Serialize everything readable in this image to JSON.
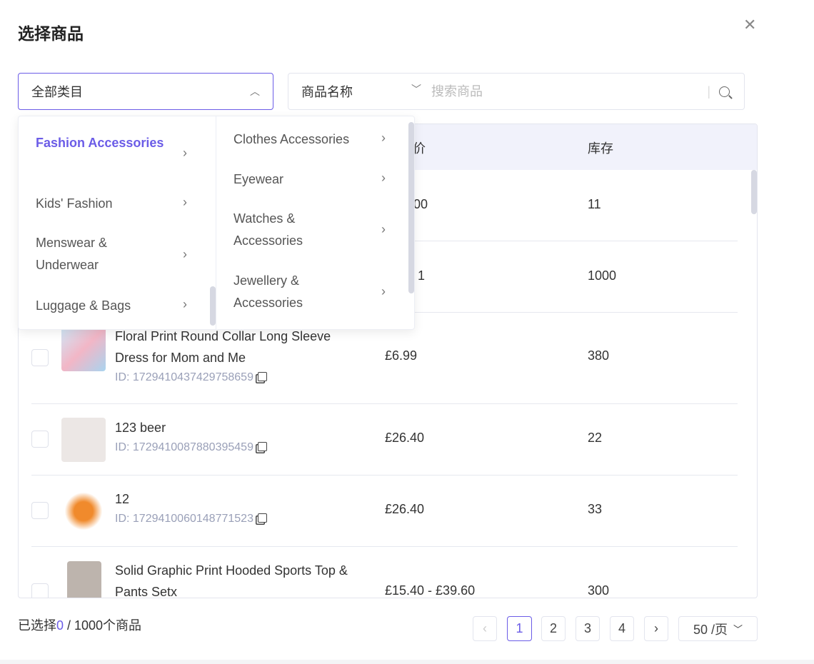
{
  "dialog": {
    "title": "选择商品",
    "close_icon": "close-icon"
  },
  "filters": {
    "category": "全部类目",
    "search_field": "商品名称",
    "search_placeholder": "搜索商品"
  },
  "table": {
    "headers": {
      "price": "价",
      "stock": "库存"
    },
    "rows": [
      {
        "name": "",
        "id": "",
        "price": "00",
        "stock": "11"
      },
      {
        "name": "",
        "id": "",
        "price": "1",
        "stock": "1000"
      },
      {
        "name": "Floral Print Round Collar Long Sleeve Dress for Mom and Me",
        "id": "ID: 1729410437429758659",
        "price": "£6.99",
        "stock": "380"
      },
      {
        "name": "123 beer",
        "id": "ID: 1729410087880395459",
        "price": "£26.40",
        "stock": "22"
      },
      {
        "name": "12",
        "id": "ID: 1729410060148771523",
        "price": "£26.40",
        "stock": "33"
      },
      {
        "name": "Solid Graphic Print Hooded Sports Top & Pants Setx",
        "id": "",
        "price": "£15.40 - £39.60",
        "stock": "300"
      }
    ]
  },
  "dropdown": {
    "level1": [
      "Fashion Accessories",
      "Kids' Fashion",
      "Menswear & Underwear",
      "Luggage & Bags"
    ],
    "level2": [
      "Clothes Accessories",
      "Eyewear",
      "Watches & Accessories",
      "Jewellery & Accessories"
    ],
    "active": "Fashion Accessories"
  },
  "footer": {
    "selected_prefix": "已选择",
    "selected_count": "0",
    "selected_suffix": " / 1000个商品",
    "pages": [
      "1",
      "2",
      "3",
      "4"
    ],
    "current_page": "1",
    "page_size": "50 /页"
  },
  "colors": {
    "accent": "#6b5ce7"
  }
}
